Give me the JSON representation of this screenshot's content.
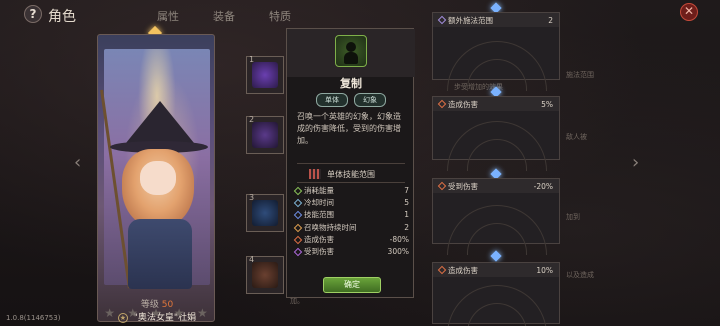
{
  "header": {
    "help_symbol": "?",
    "title": "角色",
    "tabs": [
      "属性",
      "装备",
      "特质",
      "",
      "",
      "",
      "",
      ""
    ],
    "close_symbol": "✕"
  },
  "character": {
    "level_label": "等级",
    "level_value": "50",
    "name": "\"奥法女皇\"杜娟",
    "stars": [
      "★",
      "★",
      "★",
      "★",
      "★"
    ]
  },
  "skill_slots": [
    {
      "num": "1"
    },
    {
      "num": "2"
    },
    {
      "num": "3"
    },
    {
      "num": "4"
    }
  ],
  "popup": {
    "title": "复制",
    "tags": [
      "单体",
      "幻象"
    ],
    "description": "召唤一个英雄的幻象，幻象造成的伤害降低，受到的伤害增加。",
    "range_title": "单体技能范围",
    "stats": [
      {
        "label": "消耗能量",
        "value": "7",
        "color": "#8cc65a"
      },
      {
        "label": "冷却时间",
        "value": "5",
        "color": "#7fb6d8"
      },
      {
        "label": "技能范围",
        "value": "1",
        "color": "#6f8fe6"
      },
      {
        "label": "召唤物持续时间",
        "value": "2",
        "color": "#e0a050"
      },
      {
        "label": "造成伤害",
        "value": "-80%",
        "color": "#e07045"
      },
      {
        "label": "受到伤害",
        "value": "300%",
        "color": "#b06ae0"
      }
    ],
    "confirm_label": "确定"
  },
  "bonus_panels": [
    {
      "label": "额外施法范围",
      "value": "2",
      "color": "#a58fe0"
    },
    {
      "label": "造成伤害",
      "value": "5%",
      "color": "#e07045"
    },
    {
      "label": "受到伤害",
      "value": "-20%",
      "color": "#e07045"
    },
    {
      "label": "造成伤害",
      "value": "10%",
      "color": "#e07045"
    }
  ],
  "ghost_text": {
    "right_1": "施法范围",
    "right_2": "步受增加的效果",
    "right_3": "敌人被",
    "right_4": "加到",
    "right_5": "以及造成",
    "bottom": "加。"
  },
  "version": "1.0.8(1146753)"
}
